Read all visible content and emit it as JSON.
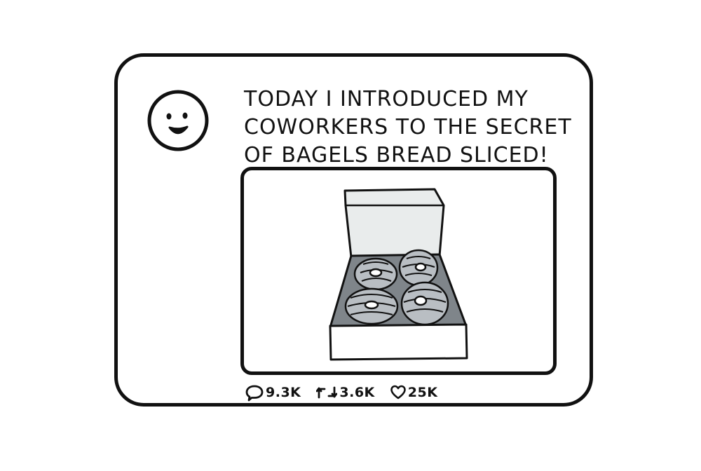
{
  "post": {
    "text_lines": [
      "TODAY I INTRODUCED MY",
      "COWORKERS TO THE SECRET",
      "OF BAGELS BREAD SLICED!"
    ],
    "avatar_icon": "smiley-face-icon",
    "image_subject": "box-of-bagels"
  },
  "stats": {
    "replies": "9.3K",
    "reposts": "3.6K",
    "likes": "25K"
  },
  "icons": {
    "reply": "speech-bubble-icon",
    "repost": "repost-arrows-icon",
    "like": "heart-icon"
  },
  "colors": {
    "ink": "#111111",
    "paper": "#ffffff",
    "bagel_gray": "#b9bec3",
    "box_inside": "#7f858a",
    "box_lid": "#e9ecec"
  }
}
